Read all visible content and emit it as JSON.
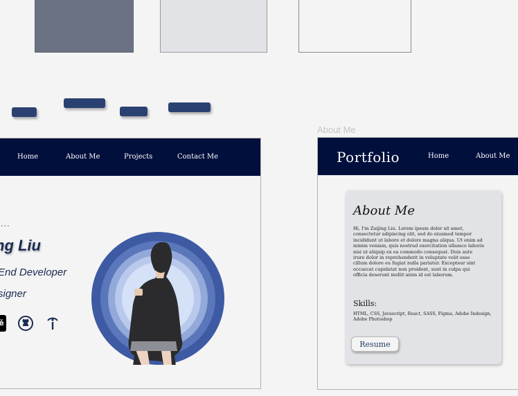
{
  "palette": {
    "swatches": [
      "#6b7283",
      "#e2e3e7",
      "#f4f4f4"
    ],
    "button_color": "#2a4171",
    "navbar_color": "#000f3c"
  },
  "home_frame": {
    "nav": [
      "Home",
      "About Me",
      "Projects",
      "Contact Me"
    ],
    "greeting": "...",
    "name": "ng Liu",
    "role_1": "End Developer",
    "role_2": "signer",
    "social_icons": [
      "behance-icon",
      "github-icon",
      "info-icon"
    ],
    "behance_glyph": "ě"
  },
  "about_frame": {
    "frame_label": "About Me",
    "brand": "Portfolio",
    "nav": [
      "Home",
      "About Me"
    ],
    "card": {
      "title": "About Me",
      "body": "Hi, I'm Zaijing Liu.  Lorem ipsum dolor sit amet, consectetur adipiscing elit, sed do eiusmod tempor incididunt ut labore et dolore magna aliqua. Ut enim ad minim veniam, quis nostrud exercitation ullamco laboris nisi ut aliquip ex ea commodo consequat. Duis aute irure dolor in reprehenderit in voluptate velit esse cillum dolore eu fugiat nulla pariatur. Excepteur sint occaecat cupidatat non proident, sunt in culpa qui officia deserunt mollit anim id est laborum.",
      "skills_title": "Skills:",
      "skills_body": "HTML, CSS, Javascript, React, SASS, Figma, Adobe Indesign, Adobe Photoshop",
      "resume_label": "Resume"
    }
  }
}
